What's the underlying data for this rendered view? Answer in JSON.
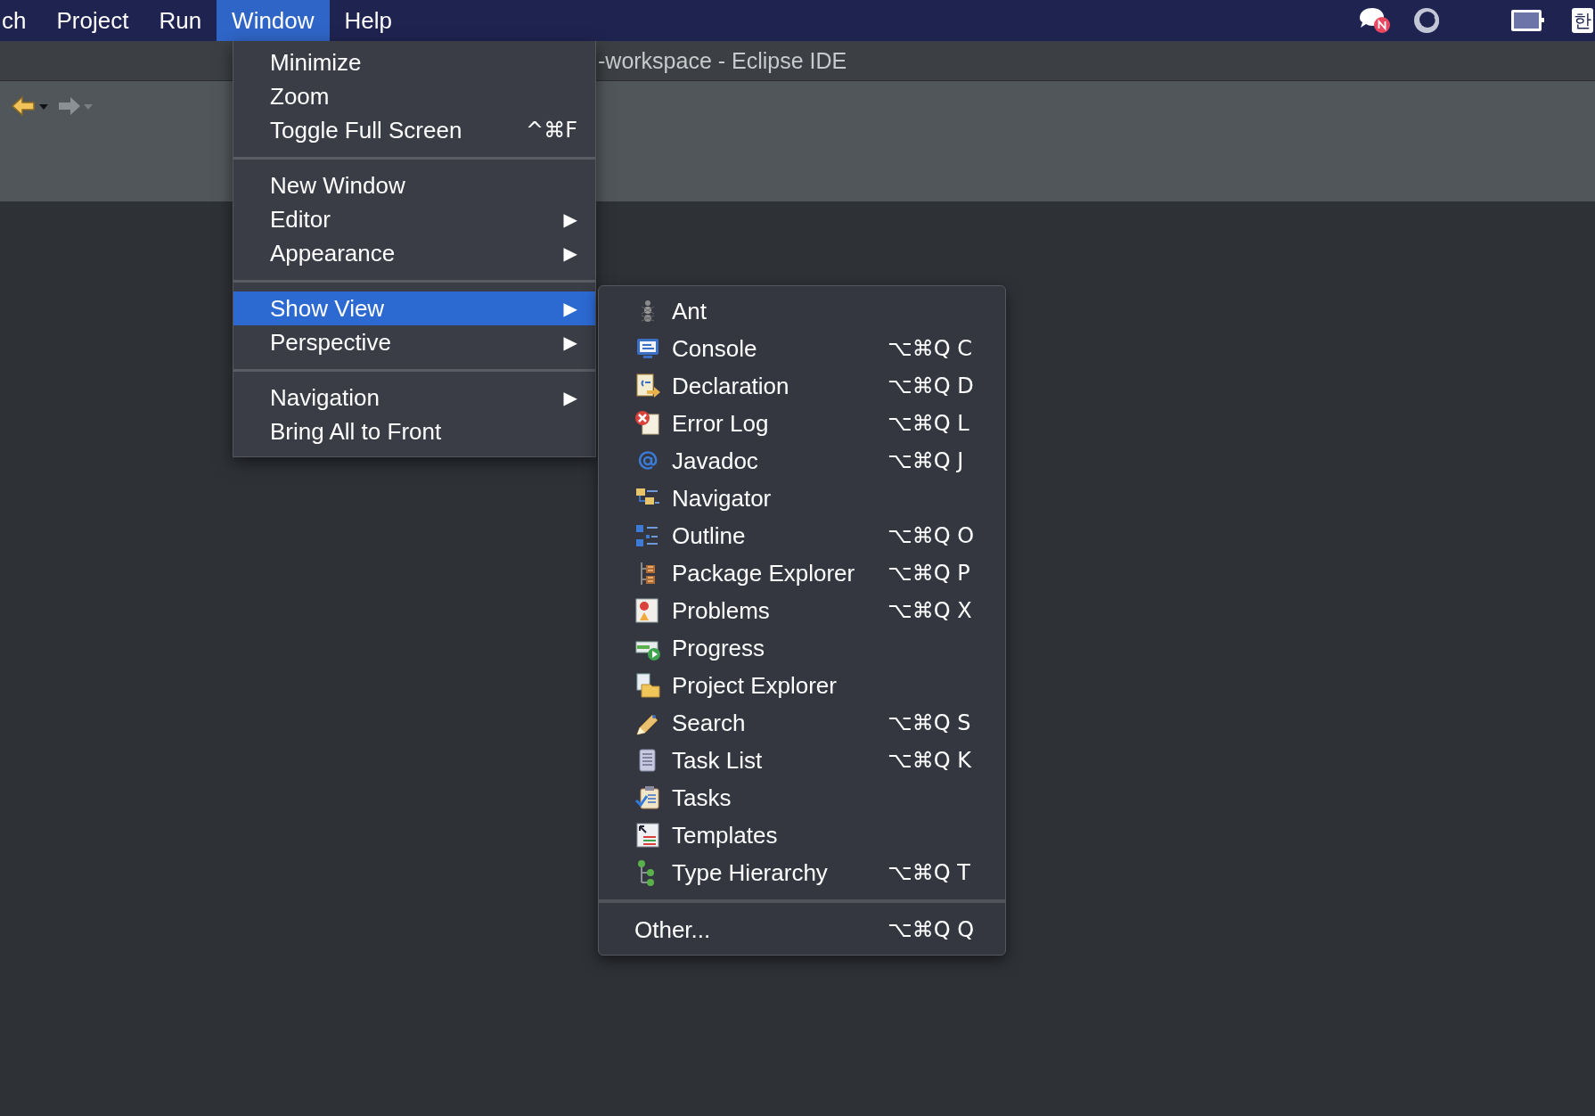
{
  "menu_bar": {
    "items": [
      {
        "label": "ch",
        "selected": false
      },
      {
        "label": "Project",
        "selected": false
      },
      {
        "label": "Run",
        "selected": false
      },
      {
        "label": "Window",
        "selected": true
      },
      {
        "label": "Help",
        "selected": false
      }
    ],
    "input_source": "한"
  },
  "title_bar": {
    "title": "-workspace - Eclipse IDE"
  },
  "window_menu": {
    "groups": [
      [
        {
          "label": "Minimize",
          "selected": false,
          "submenu": false
        },
        {
          "label": "Zoom",
          "selected": false,
          "submenu": false
        },
        {
          "label": "Toggle Full Screen",
          "shortcut": "^⌘F",
          "selected": false,
          "submenu": false
        }
      ],
      [
        {
          "label": "New Window",
          "selected": false,
          "submenu": false
        },
        {
          "label": "Editor",
          "selected": false,
          "submenu": true
        },
        {
          "label": "Appearance",
          "selected": false,
          "submenu": true
        }
      ],
      [
        {
          "label": "Show View",
          "selected": true,
          "submenu": true
        },
        {
          "label": "Perspective",
          "selected": false,
          "submenu": true
        }
      ],
      [
        {
          "label": "Navigation",
          "selected": false,
          "submenu": true
        },
        {
          "label": "Bring All to Front",
          "selected": false,
          "submenu": false
        }
      ]
    ],
    "arrow": "▶"
  },
  "show_view_menu": {
    "items": [
      {
        "label": "Ant"
      },
      {
        "label": "Console",
        "shortcut": "⌥⌘Q C"
      },
      {
        "label": "Declaration",
        "shortcut": "⌥⌘Q D"
      },
      {
        "label": "Error Log",
        "shortcut": "⌥⌘Q L"
      },
      {
        "label": "Javadoc",
        "shortcut": "⌥⌘Q J"
      },
      {
        "label": "Navigator"
      },
      {
        "label": "Outline",
        "shortcut": "⌥⌘Q O"
      },
      {
        "label": "Package Explorer",
        "shortcut": "⌥⌘Q P"
      },
      {
        "label": "Problems",
        "shortcut": "⌥⌘Q X"
      },
      {
        "label": "Progress"
      },
      {
        "label": "Project Explorer"
      },
      {
        "label": "Search",
        "shortcut": "⌥⌘Q S"
      },
      {
        "label": "Task List",
        "shortcut": "⌥⌘Q K"
      },
      {
        "label": "Tasks"
      },
      {
        "label": "Templates"
      },
      {
        "label": "Type Hierarchy",
        "shortcut": "⌥⌘Q T"
      }
    ],
    "footer": {
      "label": "Other...",
      "shortcut": "⌥⌘Q Q"
    }
  }
}
